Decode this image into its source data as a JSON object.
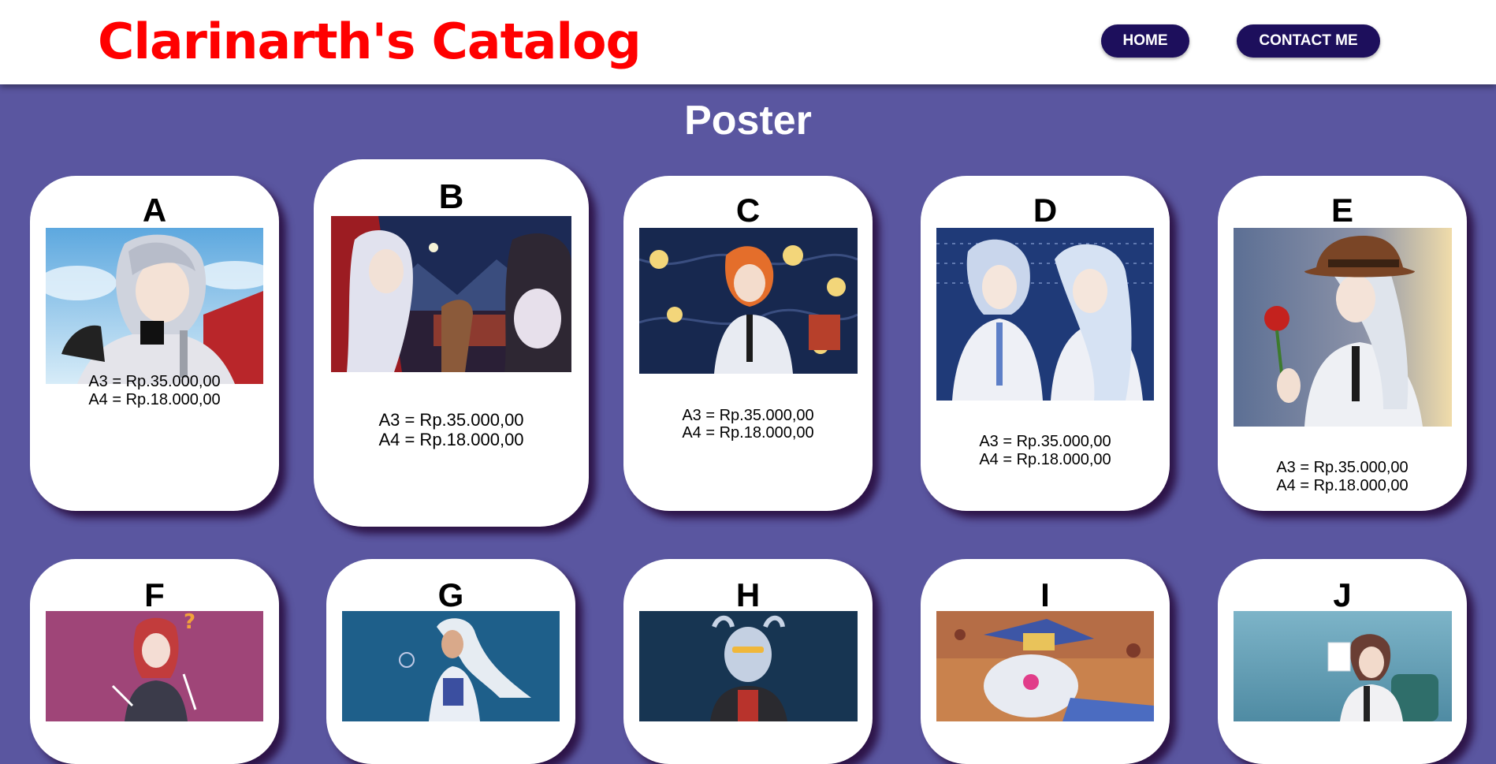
{
  "header": {
    "logo": "Clarinarth's Catalog",
    "nav": {
      "home": "HOME",
      "contact": "CONTACT ME"
    }
  },
  "section": {
    "title": "Poster"
  },
  "cards": [
    {
      "letter": "A",
      "a3": "A3 = Rp.35.000,00",
      "a4": "A4 = Rp.18.000,00",
      "art": "white-haired man in red cloak against snowy sky"
    },
    {
      "letter": "B",
      "a3": "A3 = Rp.35.000,00",
      "a4": "A4 = Rp.18.000,00",
      "art": "reindeer-eared girl with hot drink at night"
    },
    {
      "letter": "C",
      "a3": "A3 = Rp.35.000,00",
      "a4": "A4 = Rp.18.000,00",
      "art": "orange-haired scientist among light bulbs"
    },
    {
      "letter": "D",
      "a3": "A3 = Rp.35.000,00",
      "a4": "A4 = Rp.18.000,00",
      "art": "silver-haired pair in white coats"
    },
    {
      "letter": "E",
      "a3": "A3 = Rp.35.000,00",
      "a4": "A4 = Rp.18.000,00",
      "art": "silver-haired woman in brown hat holding a rose"
    },
    {
      "letter": "F",
      "art": "red-haired girl on pink background"
    },
    {
      "letter": "G",
      "art": "white-haired woman on blue background"
    },
    {
      "letter": "H",
      "art": "horned character on dark blue background"
    },
    {
      "letter": "I",
      "art": "creature with blue hat on orange background"
    },
    {
      "letter": "J",
      "art": "brown-haired man reading on teal background"
    }
  ]
}
